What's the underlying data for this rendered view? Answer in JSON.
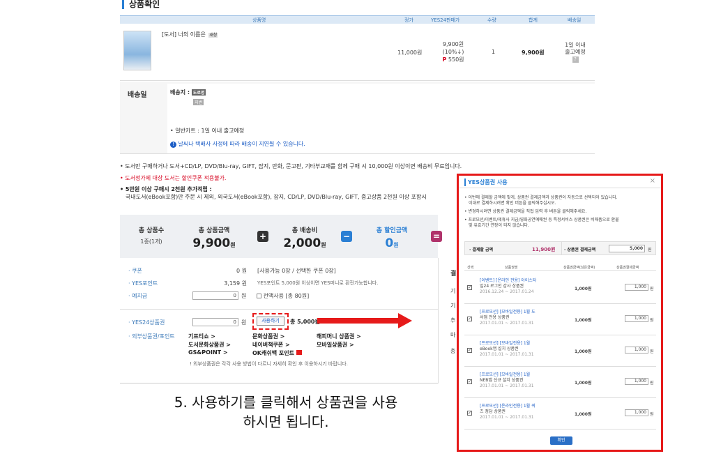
{
  "page_title": "상품확인",
  "table_headers": [
    "상품명",
    "정가",
    "YES24판매가",
    "수량",
    "합계",
    "배송일"
  ],
  "product": {
    "name": "[도서] 너의 이름은",
    "badge": "새창",
    "price": "11,000원",
    "sale": "9,900원",
    "discount": "(10%↓)",
    "point_label": "P",
    "point": "550원",
    "qty": "1",
    "total": "9,900원",
    "delivery_line1": "1일 이내",
    "delivery_line2": "출고예정",
    "help": "?"
  },
  "shipping": {
    "label": "배송일",
    "dest_label": "배송지 :",
    "dest_tag": "도로명",
    "dest_tag2": "지번",
    "line1": "• 일반카트 : 1일 이내 출고예정",
    "line2": "날씨나 택배사 사정에 따라 배송이 지연될 수 있습니다."
  },
  "notices": [
    "• 도서만 구매하거나 도서+CD/LP, DVD/Blu-ray, GIFT, 잡지, 만화, 문고판, 기타부교재를 함께 구매 시 10,000원 이상이면 배송비 무료입니다.",
    "• 도서정가제 대상 도서는 할인쿠폰 적용불가.",
    "• 5만원 이상 구매시 2천원 추가적립 :",
    "국내도서(eBook포함)만 주문 시 제외, 외국도서(eBook포함), 잡지, CD/LP, DVD/Blu-ray, GIFT, 중고상품 2천원 이상 포함시"
  ],
  "summary": {
    "count_label": "총 상품수",
    "count_value": "1종(1개)",
    "amount_label": "총 상품금액",
    "amount_value": "9,900",
    "amount_unit": "원",
    "ship_label": "총 배송비",
    "ship_value": "2,000",
    "ship_unit": "원",
    "disc_label": "총 할인금액",
    "disc_value": "0",
    "disc_unit": "원",
    "plus": "+",
    "minus": "−",
    "minus2": "="
  },
  "payment": {
    "coupon_label": "· 쿠폰",
    "coupon_value": "0 원",
    "coupon_note": "[사용가능 0장 / 선택한 쿠폰 0장]",
    "point_label": "· YES포인트",
    "point_value": "3,159 원",
    "point_note": "YES포인트 5,000원 이상이면 YES머니로 환전가능합니다.",
    "deposit_label": "· 예치금",
    "deposit_value": "0",
    "deposit_unit": "원",
    "deposit_check": "전액사용",
    "deposit_total": "[총 80원]",
    "gift_label": "· YES24상품권",
    "gift_value": "0",
    "gift_unit": "원",
    "use_button": "사용하기",
    "gift_total": "총 5,000원",
    "ext_label": "· 외부상품권/포인트",
    "ext_links": [
      "기프티쇼 >",
      "문화상품권 >",
      "해피머니 상품권 >",
      "도서문화상품권 >",
      "네이버책쿠폰 >",
      "모바일상품권 >",
      "GS&POINT >",
      "OK캐쉬백 포인트"
    ],
    "ext_note": "! 외부상품권은 각각 사용 방법이 다르니 자세히 확인 후 이용하시기 바랍니다.",
    "side_labels": [
      "결",
      "기",
      "기",
      "추",
      "마",
      "총"
    ]
  },
  "caption_line1": "5. 사용하기를 클릭해서 상품권을 사용",
  "caption_line2": "하시면 됩니다.",
  "modal": {
    "title": "YES상품권 사용",
    "close": "×",
    "info1": "• 이번에 결제할 금액에 맞게, 상품권 결제금액과 상품권이 자동으로 선택되어 있습니다.",
    "info1b": "이대로 결제하시려면 확인 버튼을 클릭해주십시오.",
    "info2": "• 변경하시려면 상품권 결제금액을 직접 입력 후 버튼을 클릭해주세요.",
    "info3": "• 프로모션/이벤트/제휴사 지급/영화공연예매권 등 특정서비스 상품권은 비매품으로 환불",
    "info3b": "및 유효기간 연장이 되지 않습니다.",
    "pay_label": "· 결제할 금액",
    "pay_value": "11,900원",
    "gift_pay_label": "· 상품권 결제금액",
    "gift_pay_value": "5,000",
    "gift_pay_unit": "원",
    "cols": [
      "선택",
      "상품권명",
      "상품권금액(남은금액)",
      "상품권결제금액"
    ],
    "rows": [
      {
        "l1": "[이벤트] [온라인 전용] 아이스타",
        "l2": "일24 로그인 감사 상품권",
        "date": "2016.12.24 ~ 2017.01.24",
        "amount": "1,000원",
        "pay": "1,000",
        "unit": "원"
      },
      {
        "l1": "[프로모션] [모바일전용] 1월 도",
        "l2": "서앱 전용 상품권",
        "date": "2017.01.01 ~ 2017.01.31",
        "amount": "1,000원",
        "pay": "1,000",
        "unit": "원"
      },
      {
        "l1": "[프로모션] [모바일전용] 1월",
        "l2": "eBook앱 설치 상품권",
        "date": "2017.01.01 ~ 2017.01.31",
        "amount": "1,000원",
        "pay": "1,000",
        "unit": "원"
      },
      {
        "l1": "[프로모션] [모바일전용] 1월",
        "l2": "NEB앱 신규 설치 상품권",
        "date": "2017.01.01 ~ 2017.01.31",
        "amount": "1,000원",
        "pay": "1,000",
        "unit": "원"
      },
      {
        "l1": "[프로모션] [온라인전용] 1월 퀴",
        "l2": "즈 정답 상품권",
        "date": "2017.01.01 ~ 2017.01.31",
        "amount": "1,000원",
        "pay": "1,000",
        "unit": "원"
      }
    ],
    "confirm": "확인"
  },
  "colors": {
    "accent": "#2a7fd4",
    "red": "#e61a1a",
    "price": "#d6001c"
  }
}
